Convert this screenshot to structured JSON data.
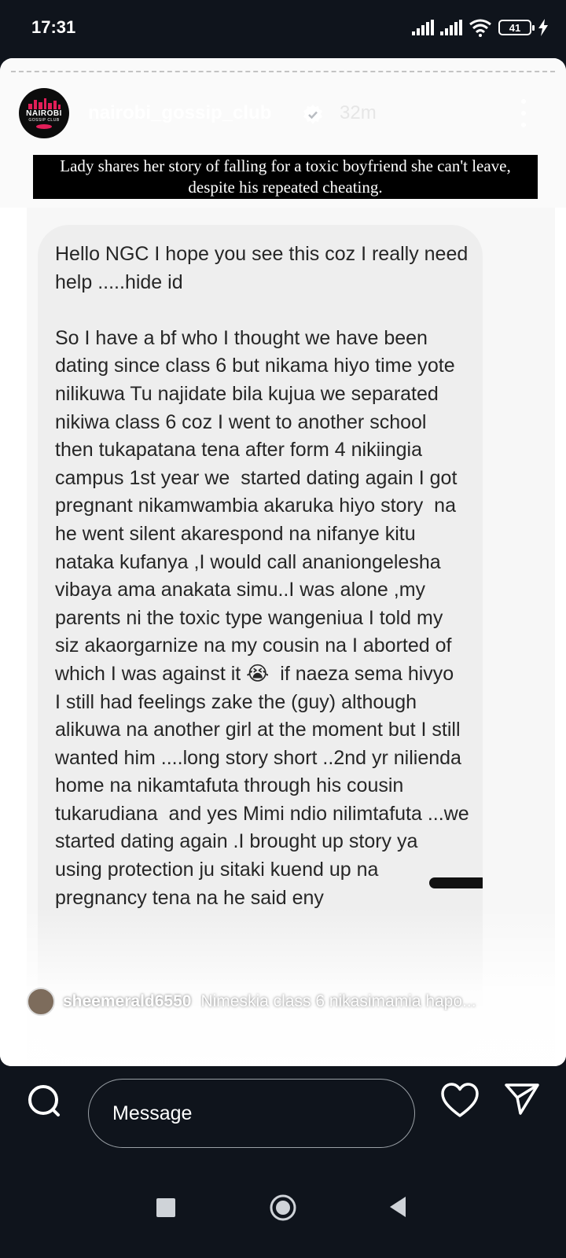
{
  "status_bar": {
    "time": "17:31",
    "battery": "41",
    "icons": [
      "signal-icon",
      "signal-icon",
      "wifi-icon",
      "battery-icon",
      "charging-bolt-icon"
    ]
  },
  "story": {
    "username": "nairobi_gossip_club",
    "time_ago": "32m",
    "avatar": {
      "line1": "NAIROBI",
      "line2": "GOSSIP CLUB"
    },
    "caption": "Lady shares her story of falling for a toxic boyfriend she can't leave, despite his repeated cheating.",
    "message": "Hello NGC I hope you see this coz I really need help .....hide id\n\nSo I have a bf who I thought we have been dating since class 6 but nikama hiyo time yote nilikuwa Tu najidate bila kujua we separated nikiwa class 6 coz I went to another school then tukapatana tena after form 4 nikiingia campus 1st year we  started dating again I got pregnant nikamwambia akaruka hiyo story  na he went silent akarespond na nifanye kitu nataka kufanya ,I would call ananiongelesha vibaya ama anakata simu..I was alone ,my parents ni the toxic type wangeniua I told my siz akaorgarnize na my cousin na I aborted of which I was against it 😭  if naeza sema hivyo  I still had feelings zake the (guy) although alikuwa na another girl at the moment but I still wanted him ....long story short ..2nd yr nilienda home na nikamtafuta through his cousin tukarudiana  and yes Mimi ndio nilimtafuta ...we started dating again .I brought up story ya using protection ju sitaki kuend up na pregnancy tena na he said eny",
    "comment": {
      "user": "sheemerald6550",
      "text": "Nimeskia class 6 nikasimamia hapo..."
    }
  },
  "reply": {
    "placeholder": "Message"
  },
  "colors": {
    "background": "#0f141c",
    "bubble": "#eeeeee",
    "text": "#262626",
    "brand_pink": "#e21e58"
  }
}
